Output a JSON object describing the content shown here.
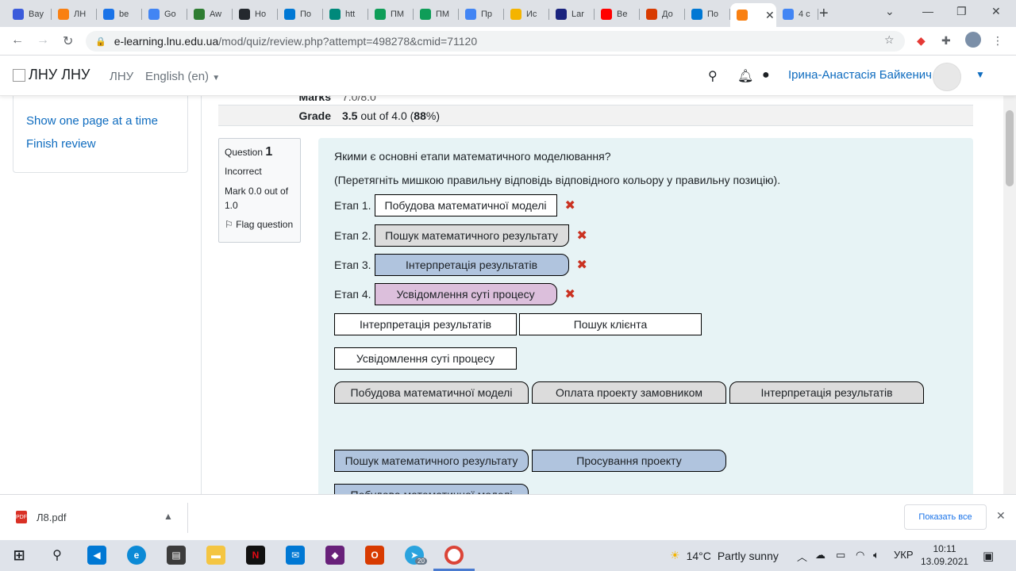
{
  "browser": {
    "tabs": [
      {
        "label": "Bay",
        "icon": "search-icon",
        "color": "#3b5bdb"
      },
      {
        "label": "ЛН",
        "icon": "moodle-icon",
        "color": "#f98012"
      },
      {
        "label": "be",
        "icon": "site-icon",
        "color": "#1a73e8"
      },
      {
        "label": "Go",
        "icon": "translate-icon",
        "color": "#4285f4"
      },
      {
        "label": "Aw",
        "icon": "site-icon",
        "color": "#2e7d32"
      },
      {
        "label": "Ho",
        "icon": "github-icon",
        "color": "#24292e"
      },
      {
        "label": "По",
        "icon": "outlook-icon",
        "color": "#0078d4"
      },
      {
        "label": "htt",
        "icon": "site-icon",
        "color": "#00897b"
      },
      {
        "label": "ПМ",
        "icon": "sheets-icon",
        "color": "#0f9d58"
      },
      {
        "label": "ПМ",
        "icon": "sheets-icon",
        "color": "#0f9d58"
      },
      {
        "label": "Пр",
        "icon": "docs-icon",
        "color": "#4285f4"
      },
      {
        "label": "Ис",
        "icon": "site-icon",
        "color": "#f4b400"
      },
      {
        "label": "Lar",
        "icon": "site-icon",
        "color": "#1a237e"
      },
      {
        "label": "Be",
        "icon": "youtube-icon",
        "color": "#ff0000"
      },
      {
        "label": "До",
        "icon": "office-icon",
        "color": "#d83b01"
      },
      {
        "label": "По",
        "icon": "outlook-icon",
        "color": "#0078d4"
      },
      {
        "label": "",
        "icon": "moodle-icon",
        "color": "#f98012",
        "active": true
      },
      {
        "label": "4 с",
        "icon": "google-icon",
        "color": "#4285f4"
      }
    ],
    "url_host": "e-learning.lnu.edu.ua",
    "url_rest": "/mod/quiz/review.php?attempt=498278&cmid=71120"
  },
  "navbar": {
    "brand": "ЛНУ ЛНУ",
    "home_link": "ЛНУ",
    "language": "English (en)",
    "user_name": "Ірина-Анастасія Байкенич"
  },
  "sidebar": {
    "show_one_page": "Show one page at a time",
    "finish_review": "Finish review"
  },
  "summary": {
    "marks_label": "Marks",
    "marks_value": "7.0/8.0",
    "grade_label": "Grade",
    "grade_bold": "3.5",
    "grade_mid": " out of 4.0 (",
    "grade_pct": "88",
    "grade_end": "%)"
  },
  "question_info": {
    "question_word": "Question",
    "number": "1",
    "state": "Incorrect",
    "mark": "Mark 0.0 out of 1.0",
    "flag": "Flag question"
  },
  "question": {
    "text": "Якими є  основні етапи математичного моделювання?",
    "instruction": "(Перетягніть мишкою правильну відповідь відповідного кольору у правильну позицію).",
    "stages": [
      {
        "label": "Етап 1.",
        "answer": "Побудова математичної моделі",
        "color": "#ffffff"
      },
      {
        "label": "Етап 2.",
        "answer": "Пошук математичного результату",
        "color": "#dcdcdc"
      },
      {
        "label": "Етап 3.",
        "answer": "Інтерпретація результатів",
        "color": "#b0c4de"
      },
      {
        "label": "Етап 4.",
        "answer": "Усвідомлення суті процесу",
        "color": "#dcbfdc"
      }
    ],
    "choices_row1": [
      "Інтерпретація результатів",
      "Пошук клієнта"
    ],
    "choices_row2": [
      "Усвідомлення суті процесу"
    ],
    "choices_row3": [
      "Побудова математичної моделі",
      "Оплата проекту замовником",
      "Інтерпретація результатів"
    ],
    "choices_row4": [
      "Пошук математичного результату",
      "Просування проекту"
    ],
    "choices_row5": [
      "Побудова математичної моделі"
    ],
    "group_colors": {
      "white": "#ffffff",
      "grey": "#dcdcdc",
      "blue": "#b0c4de"
    }
  },
  "downloads": {
    "file": "Л8.pdf",
    "show_all": "Показать все"
  },
  "taskbar": {
    "temp": "14°C",
    "weather": "Partly sunny",
    "lang": "УКР",
    "time": "10:11",
    "date": "13.09.2021",
    "telegram_badge": "20"
  }
}
